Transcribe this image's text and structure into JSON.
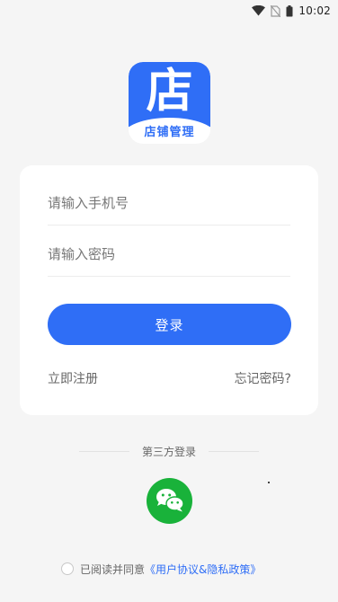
{
  "status_bar": {
    "time": "10:02",
    "icons": [
      "wifi-icon",
      "no-sim-icon",
      "battery-icon"
    ]
  },
  "logo": {
    "char": "店",
    "caption": "店铺管理"
  },
  "login_form": {
    "phone_placeholder": "请输入手机号",
    "password_placeholder": "请输入密码",
    "phone_value": "",
    "password_value": "",
    "login_label": "登录",
    "register_label": "立即注册",
    "forgot_label": "忘记密码?"
  },
  "third_party": {
    "label": "第三方登录",
    "providers": [
      "wechat-icon"
    ]
  },
  "agreement": {
    "checked": false,
    "prefix": "已阅读并同意",
    "link": "《用户协议&隐私政策》"
  },
  "colors": {
    "primary": "#2f6ef6",
    "wechat": "#19b23a",
    "background": "#f5f5f5",
    "card": "#ffffff"
  }
}
